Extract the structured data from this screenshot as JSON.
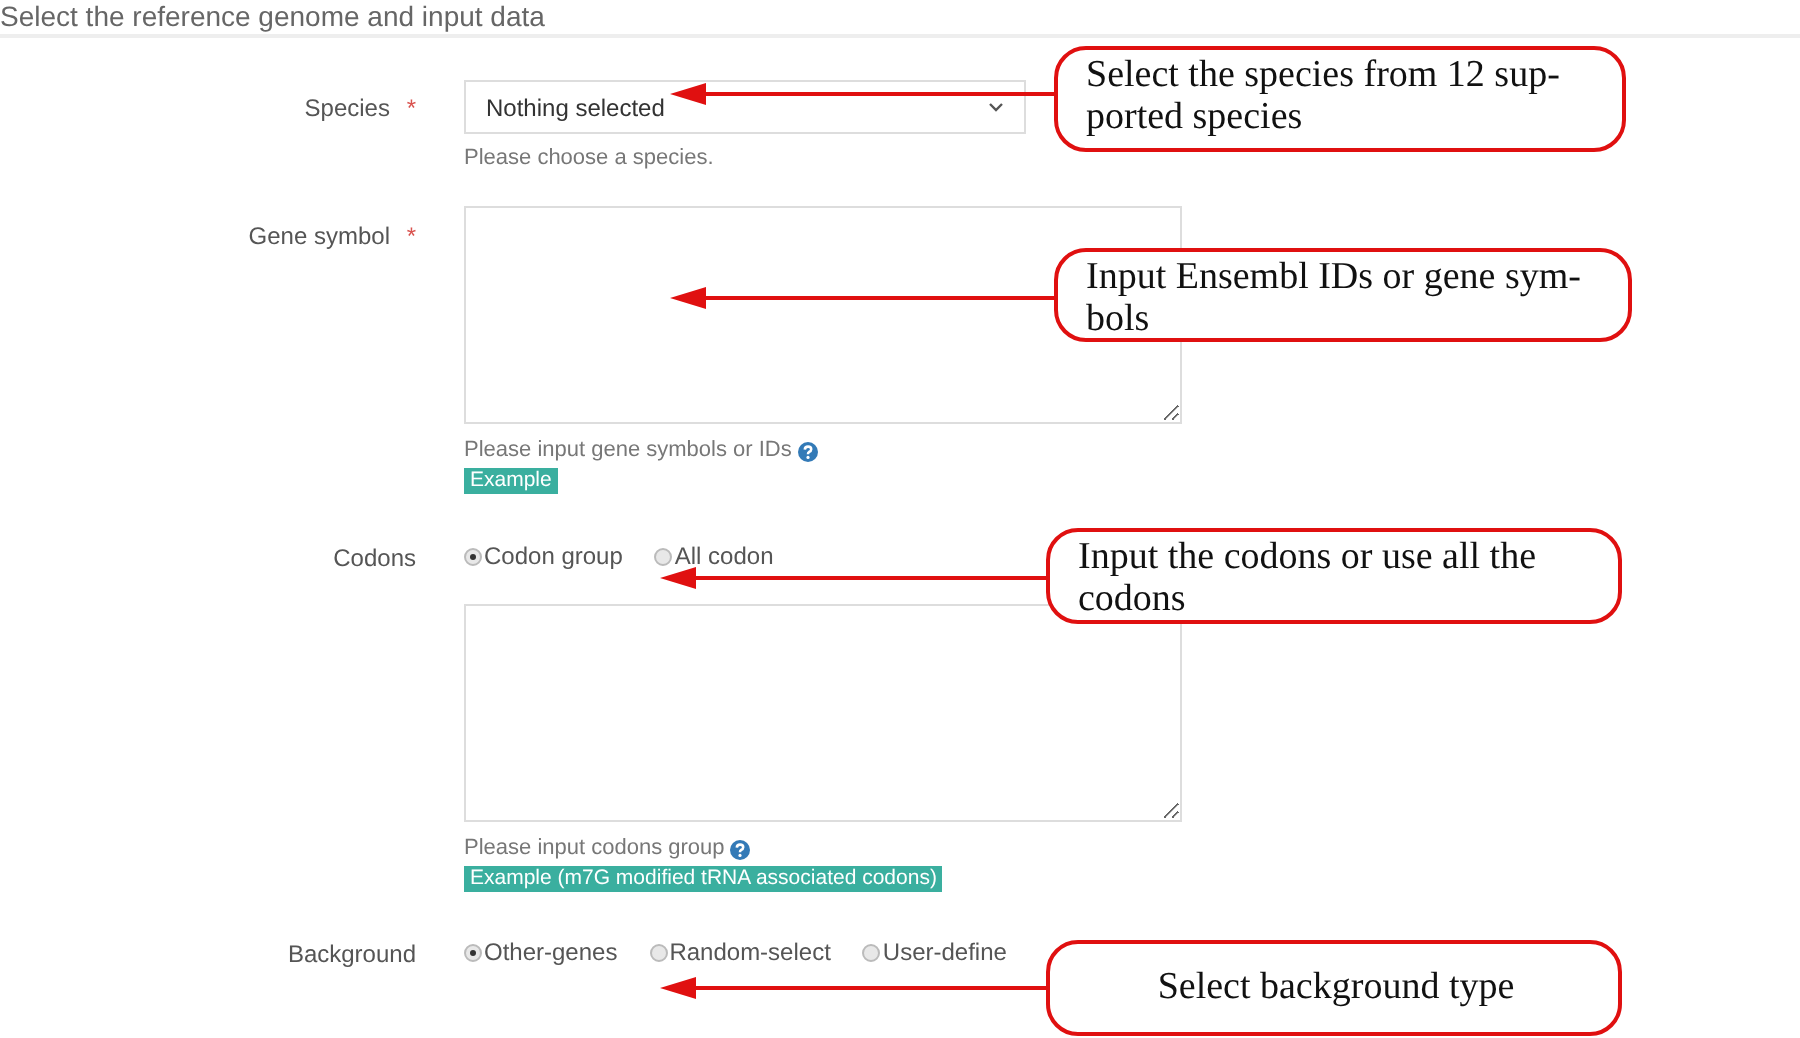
{
  "section_title": "Select the reference genome and input data",
  "fields": [
    {
      "kind": "select",
      "label": "Species",
      "required_mark": "*",
      "value": "Nothing selected",
      "hint": "Please choose a species."
    },
    {
      "kind": "textarea",
      "label": "Gene symbol",
      "required_mark": "*",
      "hint": "Please input gene symbols or IDs",
      "help_icon": true,
      "example": "Example"
    },
    {
      "kind": "radio-textarea",
      "label": "Codons",
      "options": [
        {
          "label": "Codon group",
          "selected": true
        },
        {
          "label": "All codon",
          "selected": false
        }
      ],
      "hint": "Please input codons group",
      "help_icon": true,
      "example": "Example (m7G modified tRNA associated codons)"
    },
    {
      "kind": "radio",
      "label": "Background",
      "options": [
        {
          "label": "Other-genes",
          "selected": true
        },
        {
          "label": "Random-select",
          "selected": false
        },
        {
          "label": "User-define",
          "selected": false
        }
      ]
    }
  ],
  "callouts": [
    {
      "text": "Select the species from 12 sup-\nported species"
    },
    {
      "text": "Input Ensembl IDs or gene sym-\nbols"
    },
    {
      "text": "Input the codons or use all the\ncodons"
    },
    {
      "text": "Select background type"
    }
  ]
}
